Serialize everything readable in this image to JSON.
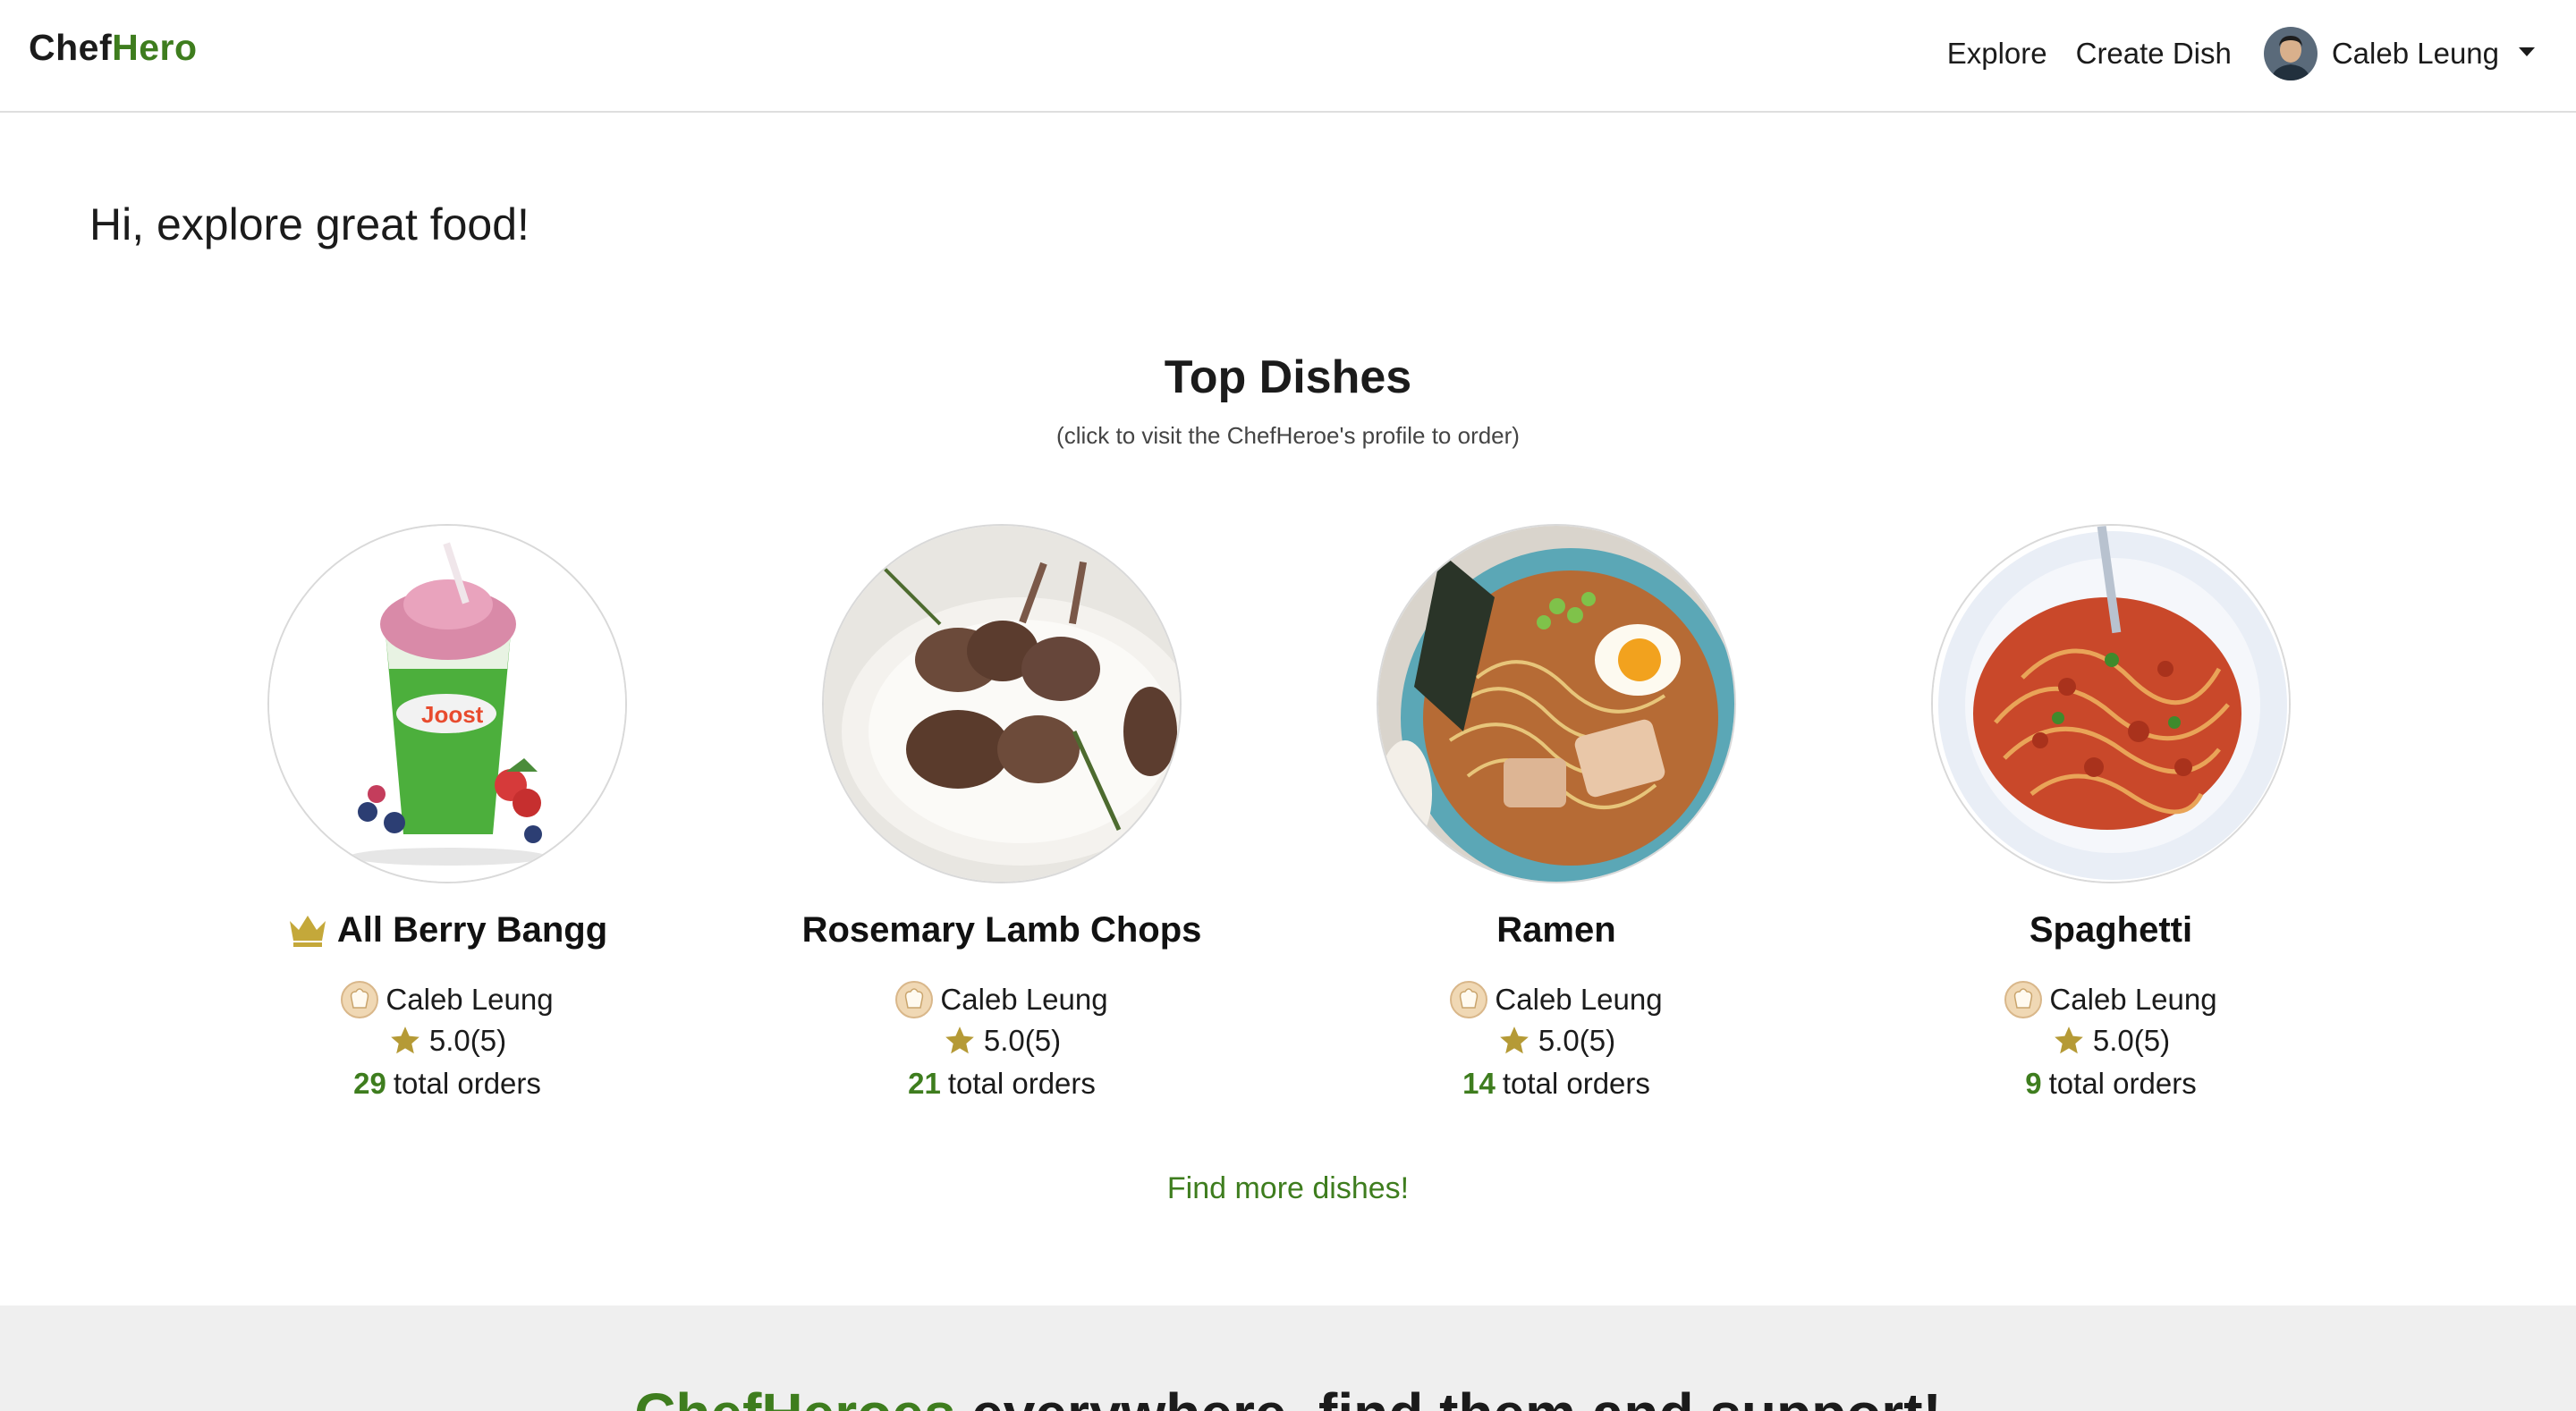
{
  "brand": {
    "part1": "Chef",
    "part2": "Hero"
  },
  "nav": {
    "explore": "Explore",
    "create_dish": "Create Dish",
    "user_name": "Caleb Leung"
  },
  "greeting": "Hi, explore great food!",
  "top_dishes": {
    "title": "Top Dishes",
    "subtitle": "(click to visit the ChefHeroe's profile to order)",
    "dishes": [
      {
        "name": "All Berry Bangg",
        "chef": "Caleb Leung",
        "rating": "5.0(5)",
        "orders_count": "29",
        "orders_label": "total orders",
        "top_crown": true
      },
      {
        "name": "Rosemary Lamb Chops",
        "chef": "Caleb Leung",
        "rating": "5.0(5)",
        "orders_count": "21",
        "orders_label": "total orders"
      },
      {
        "name": "Ramen",
        "chef": "Caleb Leung",
        "rating": "5.0(5)",
        "orders_count": "14",
        "orders_label": "total orders"
      },
      {
        "name": "Spaghetti",
        "chef": "Caleb Leung",
        "rating": "5.0(5)",
        "orders_count": "9",
        "orders_label": "total orders"
      }
    ]
  },
  "find_more": "Find more dishes!",
  "footer": {
    "accent": "ChefHeroes",
    "rest": " everywhere, find them and support!"
  },
  "colors": {
    "brand_green": "#3e7d1e",
    "star_gold": "#b59a36",
    "footer_bg": "#efefef"
  },
  "icons": [
    "crown-icon",
    "chef-hat-icon",
    "star-icon",
    "caret-down-icon",
    "avatar"
  ]
}
